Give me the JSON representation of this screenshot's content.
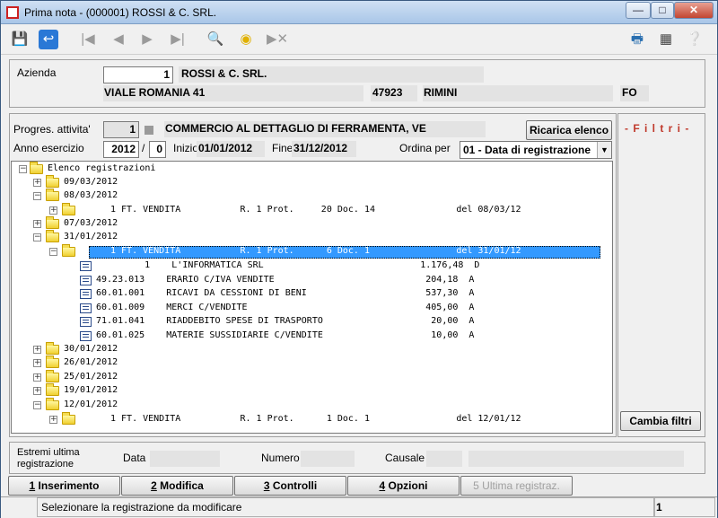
{
  "window": {
    "title": "Prima nota  -  (000001) ROSSI & C. SRL."
  },
  "header": {
    "azienda_label": "Azienda",
    "azienda_code": "1",
    "azienda_name": "ROSSI & C. SRL.",
    "address": "VIALE ROMANIA 41",
    "cap": "47923",
    "city": "RIMINI",
    "province": "FO"
  },
  "filters": {
    "progres_label": "Progres. attivita'",
    "progres_code": "1",
    "progres_desc": "COMMERCIO AL DETTAGLIO DI FERRAMENTA, VE",
    "ricarica_label": "Ricarica elenco",
    "anno_label": "Anno esercizio",
    "anno_value": "2012",
    "anno_sep": "/",
    "anno_sub": "0",
    "inizio_label": "Inizio",
    "inizio_value": "01/01/2012",
    "fine_label": "Fine",
    "fine_value": "31/12/2012",
    "ordina_label": "Ordina per",
    "ordina_value": "01 - Data di registrazione",
    "filtri_label": "- F i l t r i -",
    "cambia_label": "Cambia filtri"
  },
  "tree": {
    "root": "Elenco registrazioni",
    "rows": [
      {
        "text": "09/03/2012"
      },
      {
        "text": "08/03/2012"
      },
      {
        "text": "1 FT. VENDITA           R. 1 Prot.     20 Doc. 14               del 08/03/12"
      },
      {
        "text": "07/03/2012"
      },
      {
        "text": "31/01/2012"
      },
      {
        "text": "1 FT. VENDITA           R. 1 Prot.      6 Doc. 1                del 31/01/12"
      },
      {
        "text": "         1    L'INFORMATICA SRL                             1.176,48  D"
      },
      {
        "text": "49.23.013    ERARIO C/IVA VENDITE                            204,18  A"
      },
      {
        "text": "60.01.001    RICAVI DA CESSIONI DI BENI                      537,30  A"
      },
      {
        "text": "60.01.009    MERCI C/VENDITE                                 405,00  A"
      },
      {
        "text": "71.01.041    RIADDEBITO SPESE DI TRASPORTO                    20,00  A"
      },
      {
        "text": "60.01.025    MATERIE SUSSIDIARIE C/VENDITE                    10,00  A"
      },
      {
        "text": "30/01/2012"
      },
      {
        "text": "26/01/2012"
      },
      {
        "text": "25/01/2012"
      },
      {
        "text": "19/01/2012"
      },
      {
        "text": "12/01/2012"
      },
      {
        "text": "1 FT. VENDITA           R. 1 Prot.      1 Doc. 1                del 12/01/12"
      }
    ]
  },
  "footer": {
    "estremi_label_1": "Estremi ultima",
    "estremi_label_2": "registrazione",
    "data_label": "Data",
    "numero_label": "Numero",
    "causale_label": "Causale"
  },
  "buttons": {
    "inserimento_num": "1",
    "inserimento": " Inserimento",
    "modifica_num": "2",
    "modifica": " Modifica",
    "controlli_num": "3",
    "controlli": " Controlli",
    "opzioni_num": "4",
    "opzioni": " Opzioni",
    "ultima": "5 Ultima registraz."
  },
  "status": {
    "message": "Selezionare la registrazione da modificare",
    "page": "1"
  },
  "colors": {
    "selection": "#3399ff",
    "filtri": "#c0392b"
  }
}
